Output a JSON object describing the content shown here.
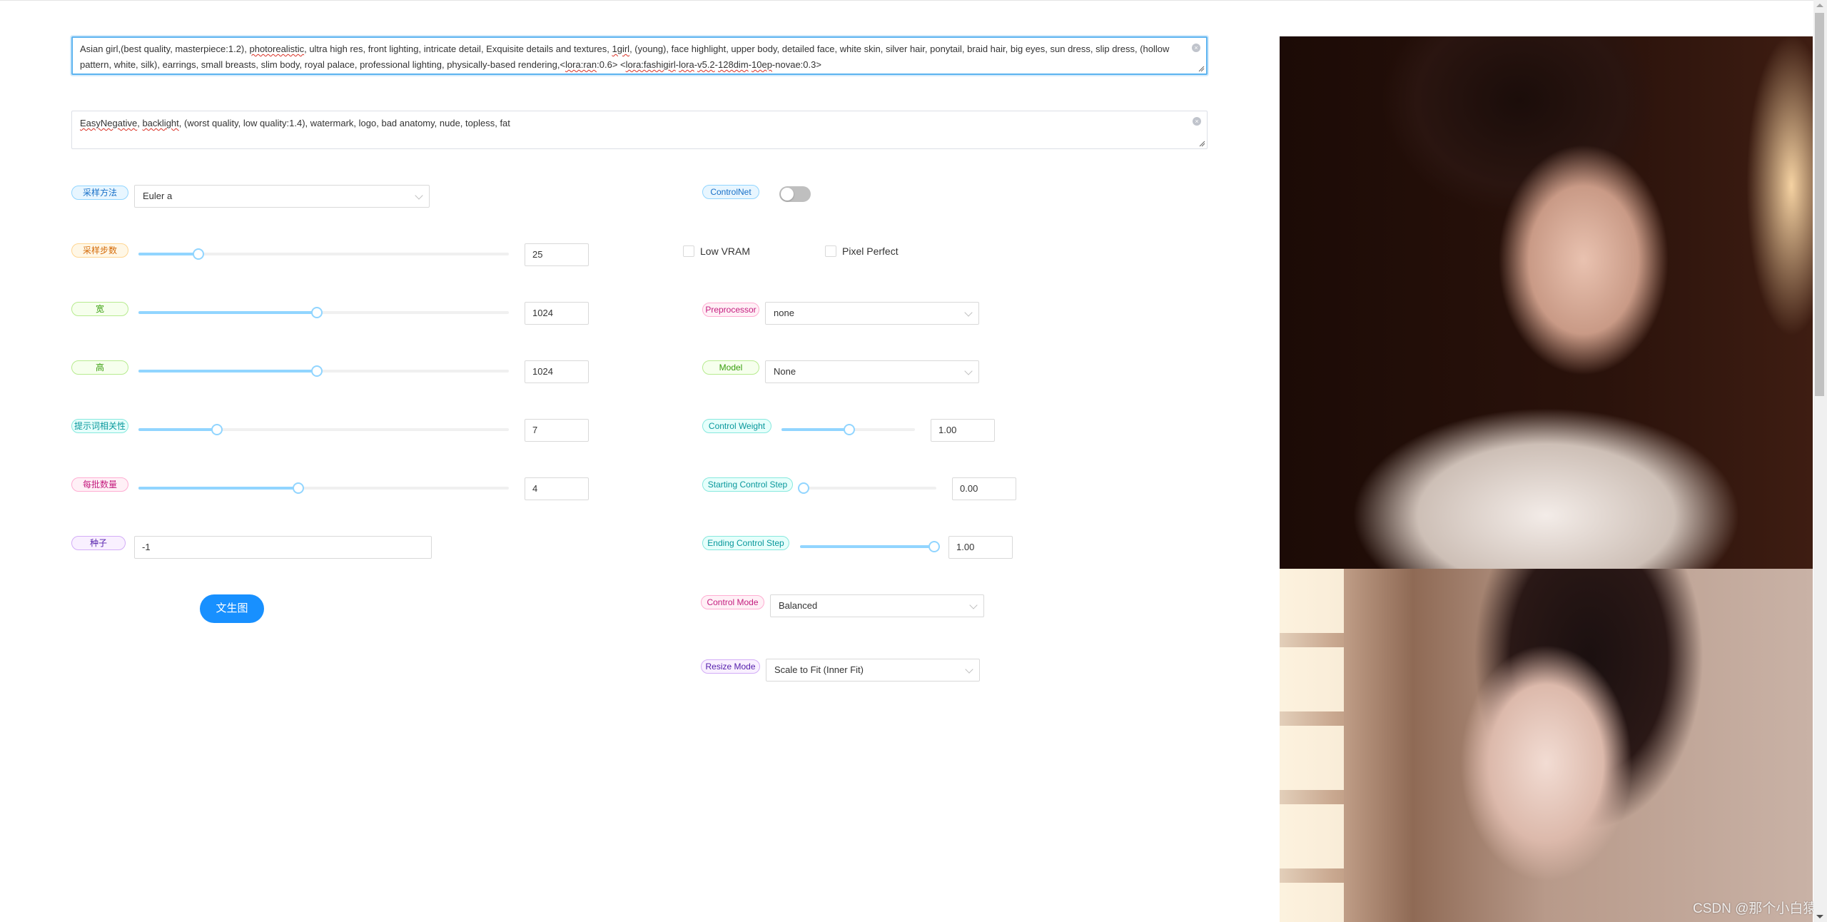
{
  "prompt": {
    "positive_parts": [
      {
        "text": "Asian girl,(best quality, masterpiece:1.2), ",
        "spell": false
      },
      {
        "text": "photorealistic",
        "spell": true
      },
      {
        "text": ", ultra high res, front lighting, intricate detail, Exquisite details and textures, ",
        "spell": false
      },
      {
        "text": "1girl",
        "spell": true
      },
      {
        "text": ", (young), face highlight, upper body, detailed face, white skin, silver hair, ponytail, braid hair, big eyes, sun dress, slip dress, (hollow pattern, white, silk), earrings, small breasts, slim body, royal palace, professional lighting, physically-based rendering,<",
        "spell": false
      },
      {
        "text": "lora:ran",
        "spell": true
      },
      {
        "text": ":0.6> <",
        "spell": false
      },
      {
        "text": "lora:fashigirl",
        "spell": true
      },
      {
        "text": "-",
        "spell": false
      },
      {
        "text": "lora",
        "spell": true
      },
      {
        "text": "-",
        "spell": false
      },
      {
        "text": "v5.2",
        "spell": true
      },
      {
        "text": "-",
        "spell": false
      },
      {
        "text": "128dim",
        "spell": true
      },
      {
        "text": "-",
        "spell": false
      },
      {
        "text": "10ep",
        "spell": true
      },
      {
        "text": "-novae:0.3>",
        "spell": false
      }
    ],
    "negative_parts": [
      {
        "text": "EasyNegative",
        "spell": true
      },
      {
        "text": ", ",
        "spell": false
      },
      {
        "text": "backlight",
        "spell": true
      },
      {
        "text": ", (worst quality, low quality:1.4), watermark, logo, bad anatomy, nude, topless, fat",
        "spell": false
      }
    ]
  },
  "left": {
    "sampler": {
      "label": "采样方法",
      "value": "Euler a"
    },
    "steps": {
      "label": "采样步数",
      "value": "25",
      "fraction": 0.16
    },
    "width": {
      "label": "宽",
      "value": "1024",
      "fraction": 0.48
    },
    "height": {
      "label": "高",
      "value": "1024",
      "fraction": 0.48
    },
    "cfg": {
      "label": "提示词相关性",
      "value": "7",
      "fraction": 0.21
    },
    "batch": {
      "label": "每批数量",
      "value": "4",
      "fraction": 0.43
    },
    "seed": {
      "label": "种子",
      "value": "-1"
    },
    "generate_button": "文生图"
  },
  "controlnet": {
    "label": "ControlNet",
    "enabled": false,
    "low_vram": {
      "label": "Low VRAM",
      "checked": false
    },
    "pixel_perfect": {
      "label": "Pixel Perfect",
      "checked": false
    },
    "preprocessor": {
      "label": "Preprocessor",
      "value": "none"
    },
    "model": {
      "label": "Model",
      "value": "None"
    },
    "control_weight": {
      "label": "Control Weight",
      "value": "1.00",
      "fraction": 0.5
    },
    "starting_step": {
      "label": "Starting Control Step",
      "value": "0.00",
      "fraction": 0.0
    },
    "ending_step": {
      "label": "Ending Control Step",
      "value": "1.00",
      "fraction": 1.0
    },
    "control_mode": {
      "label": "Control Mode",
      "value": "Balanced"
    },
    "resize_mode": {
      "label": "Resize Mode",
      "value": "Scale to Fit (Inner Fit)"
    }
  },
  "gallery": {
    "images": [
      {
        "description": "Generated portrait: woman with hair bun, gold floral earrings, white dress, warm backlight"
      },
      {
        "description": "Generated portrait: woman with braided ponytail, silver earrings, necklace, window light"
      }
    ],
    "watermark": "CSDN @那个小白猿"
  },
  "icons": {
    "clear": "×"
  }
}
